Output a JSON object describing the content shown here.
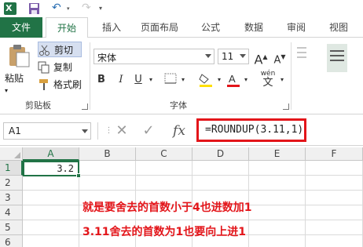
{
  "titlebar": {
    "logo_letter": "X"
  },
  "tabs": [
    "文件",
    "开始",
    "插入",
    "页面布局",
    "公式",
    "数据",
    "审阅",
    "视图"
  ],
  "active_tab": "开始",
  "clipboard": {
    "paste_label": "粘贴",
    "cut_label": "剪切",
    "copy_label": "复制",
    "format_painter_label": "格式刷",
    "group_label": "剪贴板"
  },
  "font": {
    "font_name": "宋体",
    "font_size": "11",
    "group_label": "字体",
    "phonetic_label": "wén",
    "bold": "B",
    "italic": "I",
    "underline": "U"
  },
  "formula_bar": {
    "name_box": "A1",
    "fx_label": "fx",
    "formula": "=ROUNDUP(3.11,1)"
  },
  "grid": {
    "columns": [
      "A",
      "B",
      "C",
      "D",
      "E",
      "F"
    ],
    "rows": [
      "1",
      "2",
      "3",
      "4",
      "5",
      "6"
    ],
    "active_cell_value": "3.2"
  },
  "annotation": {
    "line1": "就是要舍去的首数小于4也进数加1",
    "line2": "3.11舍去的首数为1也要向上进1",
    "color": "#e3151a"
  },
  "colors": {
    "excel_green": "#217346",
    "highlight_red": "#e3151a"
  }
}
